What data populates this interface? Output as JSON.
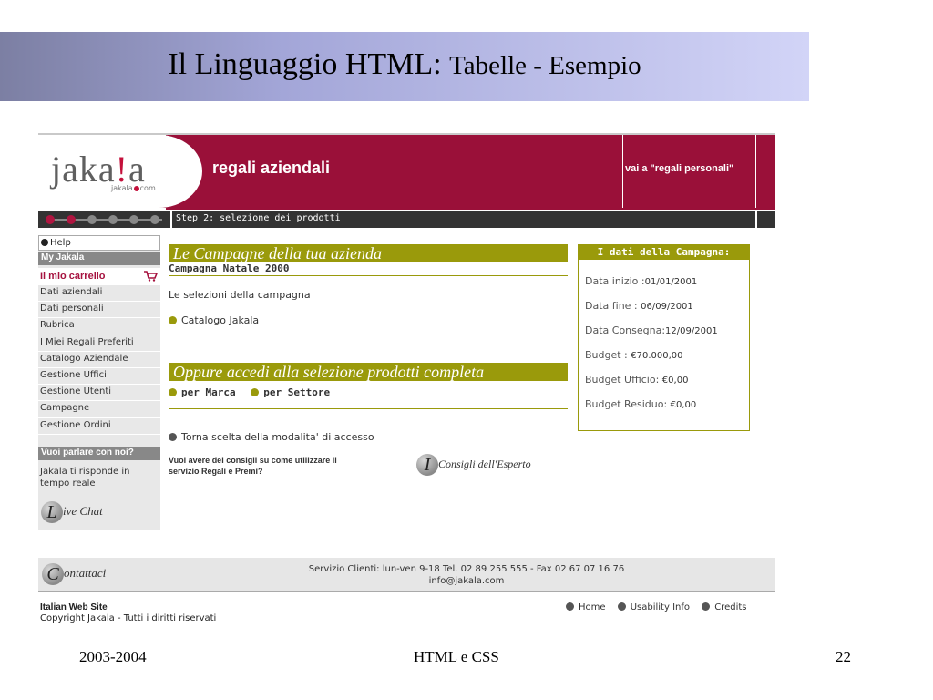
{
  "slide": {
    "title_main": "Il Linguaggio HTML:",
    "title_sub": "Tabelle - Esempio",
    "footer_left": "2003-2004",
    "footer_center": "HTML e CSS",
    "footer_page": "22"
  },
  "site": {
    "logo": {
      "part1": "jaka",
      "bang": "!",
      "part2": "a",
      "sub_left": "jakala",
      "sub_right": "com"
    },
    "heading": "regali aziendali",
    "switch_link": "vai a \"regali personali\"",
    "step_text": "Step 2: selezione dei prodotti",
    "step_dots": {
      "total": 6,
      "active": 2
    }
  },
  "sidebar": {
    "help": "Help",
    "section_my": "My Jakala",
    "cart_label": "Il mio carrello",
    "items": [
      "Dati aziendali",
      "Dati personali",
      "Rubrica",
      "I Miei Regali Preferiti",
      "Catalogo Aziendale",
      "Gestione Uffici",
      "Gestione Utenti",
      "Campagne",
      "Gestione Ordini"
    ],
    "talk_head": "Vuoi parlare con noi?",
    "talk_text": "Jakala ti risponde in tempo reale!",
    "livechat_letter": "L",
    "livechat_rest": "ive Chat"
  },
  "main": {
    "campaigns_head": "Le Campagne della tua azienda",
    "campaign_name": "Campagna Natale 2000",
    "selections": "Le selezioni della campagna",
    "catalog": "Catalogo Jakala",
    "alt_head": "Oppure accedi alla selezione prodotti completa",
    "by_brand": "per Marca",
    "by_sector": "per Settore",
    "back": "Torna scelta della modalita' di accesso",
    "advice": "Vuoi avere dei consigli su come utilizzare il servizio Regali e Premi?",
    "expert_letter": "I",
    "expert_rest": "Consigli dell'Esperto"
  },
  "campaign_box": {
    "head": "I dati della Campagna:",
    "rows": [
      {
        "label": "Data inizio :",
        "value": "01/01/2001"
      },
      {
        "label": "Data fine : ",
        "value": "06/09/2001"
      },
      {
        "label": "Data Consegna:",
        "value": "12/09/2001"
      },
      {
        "label": "Budget : ",
        "value": "€70.000,00"
      },
      {
        "label": "Budget Ufficio: ",
        "value": "€0,00"
      },
      {
        "label": "Budget Residuo: ",
        "value": "€0,00"
      }
    ]
  },
  "footer": {
    "contact_letter": "C",
    "contact_rest": "ontattaci",
    "contact_line1": "Servizio Clienti: lun-ven 9-18 Tel. 02 89 255 555 - Fax 02 67 07 16 76",
    "contact_line2": "info@jakala.com",
    "site_name": "Italian Web Site",
    "copyright": "Copyright Jakala - Tutti i diritti riservati",
    "links": [
      "Home",
      "Usability Info",
      "Credits"
    ]
  },
  "colors": {
    "brand_red": "#9a1039",
    "olive": "#9a9a0b"
  }
}
